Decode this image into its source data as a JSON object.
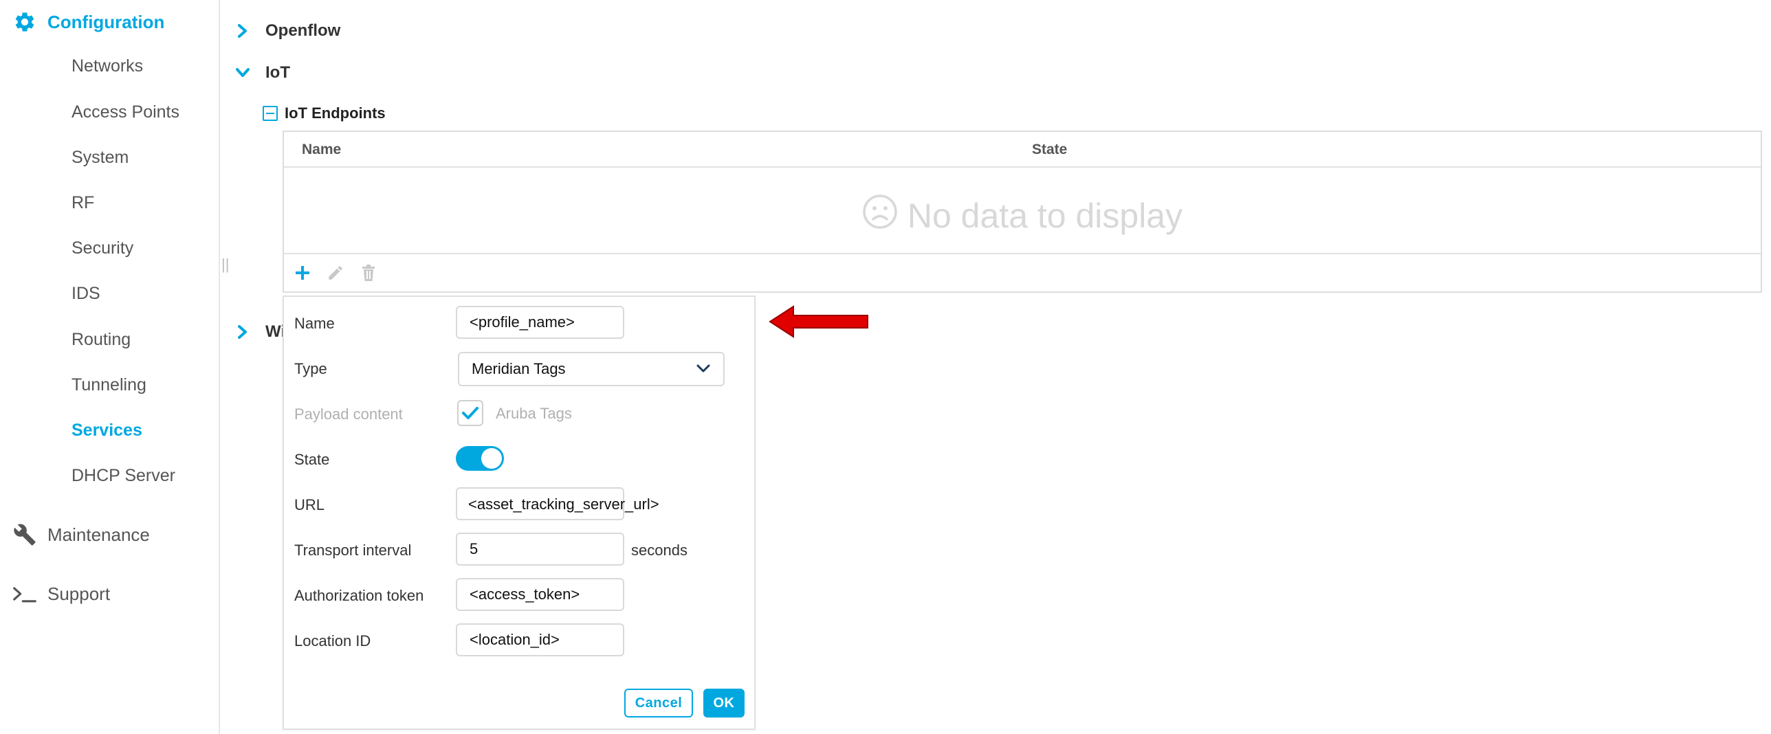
{
  "sidebar": {
    "configuration": {
      "label": "Configuration",
      "icon": "gear-icon"
    },
    "items": [
      {
        "label": "Networks"
      },
      {
        "label": "Access Points"
      },
      {
        "label": "System"
      },
      {
        "label": "RF"
      },
      {
        "label": "Security"
      },
      {
        "label": "IDS"
      },
      {
        "label": "Routing"
      },
      {
        "label": "Tunneling"
      },
      {
        "label": "Services",
        "active": true
      },
      {
        "label": "DHCP Server"
      }
    ],
    "maintenance": {
      "label": "Maintenance",
      "icon": "wrench-icon"
    },
    "support": {
      "label": "Support",
      "icon": "terminal-icon"
    },
    "splitter": "||"
  },
  "main": {
    "openflow": {
      "label": "Openflow"
    },
    "iot": {
      "label": "IoT",
      "endpoints": {
        "label": "IoT Endpoints",
        "columns": [
          "Name",
          "State"
        ],
        "empty_text": "No data to display",
        "empty_icon": "sad-face-icon"
      }
    },
    "next_section": {
      "label": "Wi"
    }
  },
  "dialog": {
    "name": {
      "label": "Name",
      "value": "<profile_name>"
    },
    "type": {
      "label": "Type",
      "value": "Meridian Tags"
    },
    "payload": {
      "label": "Payload content",
      "checkbox_label": "Aruba Tags",
      "checked": true
    },
    "state": {
      "label": "State",
      "on": true
    },
    "url": {
      "label": "URL",
      "value": "<asset_tracking_server_url>"
    },
    "interval": {
      "label": "Transport interval",
      "value": "5",
      "unit": "seconds"
    },
    "token": {
      "label": "Authorization token",
      "value": "<access_token>"
    },
    "location": {
      "label": "Location ID",
      "value": "<location_id>"
    },
    "cancel_label": "Cancel",
    "ok_label": "OK"
  },
  "colors": {
    "accent": "#01a8e0",
    "arrow": "#e00000",
    "muted_text": "#b0b0b0"
  }
}
